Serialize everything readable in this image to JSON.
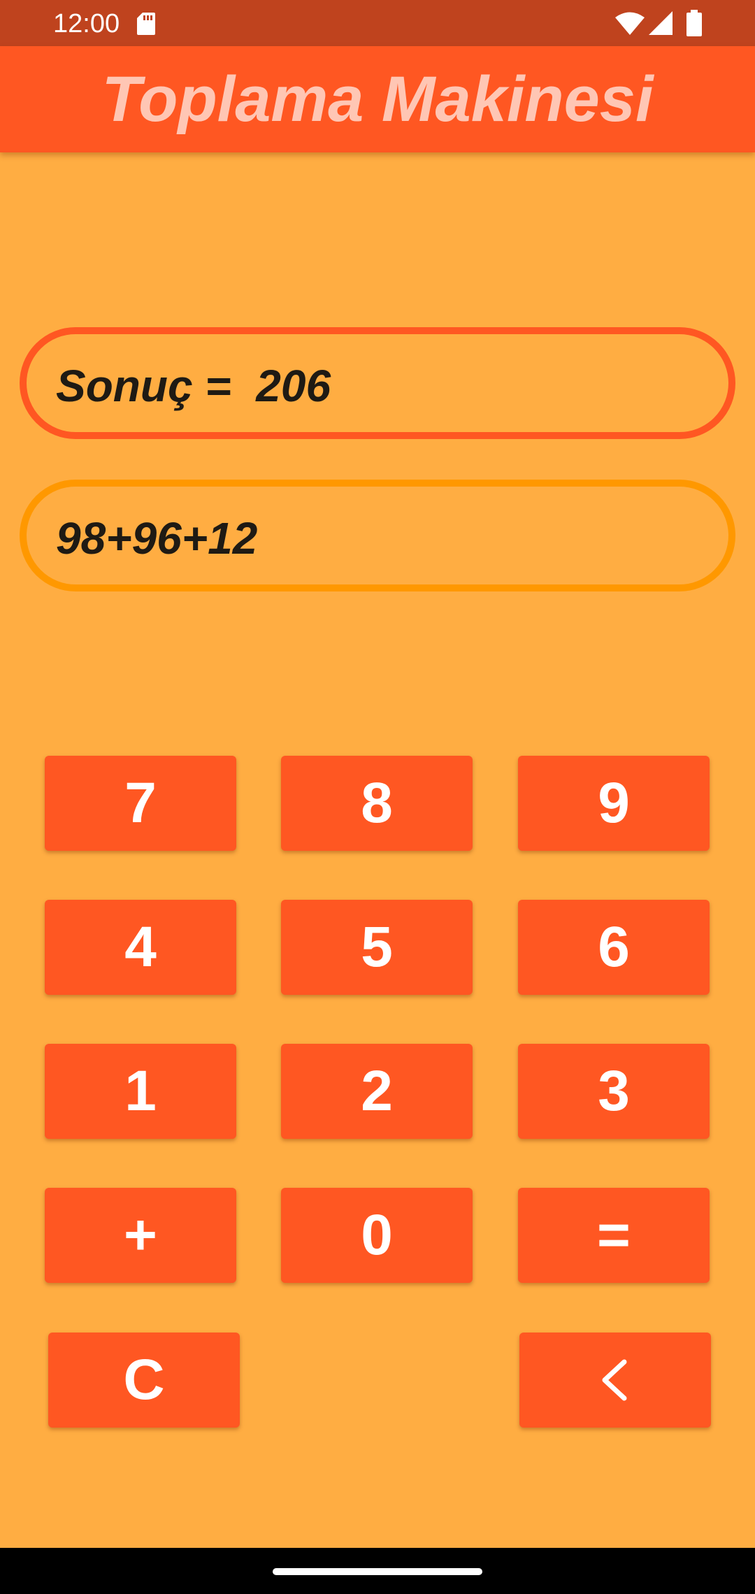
{
  "status_bar": {
    "time": "12:00",
    "icons": [
      "sd-card-icon",
      "wifi-icon",
      "signal-icon",
      "battery-icon"
    ]
  },
  "app_bar": {
    "title": "Toplama Makinesi"
  },
  "display": {
    "result_label": "Sonuç = ",
    "result_value": "206",
    "expression": "98+96+12"
  },
  "keypad": {
    "key_7": "7",
    "key_8": "8",
    "key_9": "9",
    "key_4": "4",
    "key_5": "5",
    "key_6": "6",
    "key_1": "1",
    "key_2": "2",
    "key_3": "3",
    "key_plus": "+",
    "key_0": "0",
    "key_equals": "=",
    "key_clear": "C",
    "backspace_icon": "chevron-left-icon"
  },
  "colors": {
    "background": "#FFAD42",
    "status_bar": "#BF431E",
    "primary": "#FF5722",
    "title_text": "#FFC6B4",
    "expression_border": "#FF9800",
    "display_text": "#1E1A14",
    "key_text": "#FFFFFF"
  }
}
